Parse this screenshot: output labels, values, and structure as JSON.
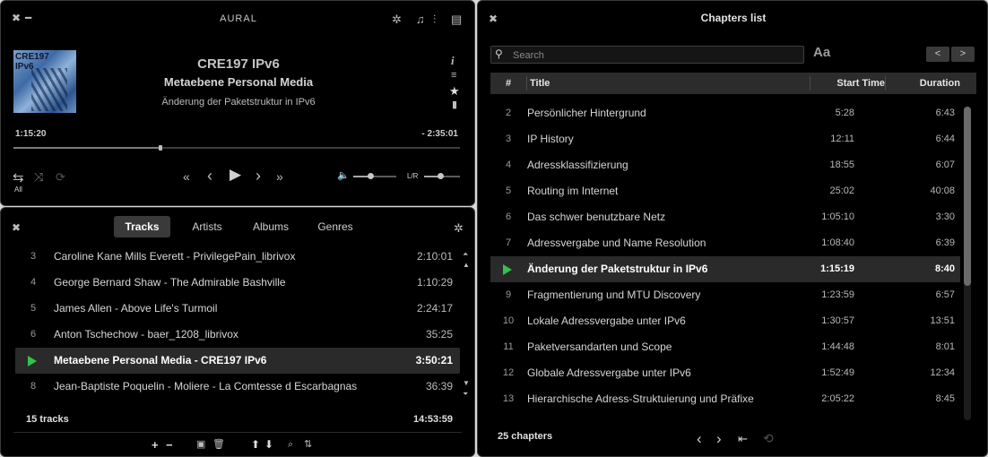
{
  "player": {
    "app_title": "AURAL",
    "album_art": {
      "line1": "CRE197",
      "line2": "IPv6"
    },
    "track_title": "CRE197 IPv6",
    "track_artist": "Metaebene Personal Media",
    "track_album": "Änderung der Paketstruktur in IPv6",
    "elapsed": "1:15:20",
    "remaining": "- 2:35:01",
    "seek_fraction": 0.33,
    "repeat_label": "All",
    "balance_label": "L/R",
    "volume_fraction": 0.4,
    "balance_fraction": 0.45,
    "colors": {
      "background": "#000000",
      "text": "#dcdcdc",
      "accent_play": "#33c24a"
    }
  },
  "playlist": {
    "tabs": [
      "Tracks",
      "Artists",
      "Albums",
      "Genres"
    ],
    "active_tab": "Tracks",
    "rows": [
      {
        "num": "3",
        "name": "Caroline Kane Mills Everett - PrivilegePain_librivox",
        "duration": "2:10:01",
        "playing": false
      },
      {
        "num": "4",
        "name": "George Bernard Shaw - The Admirable Bashville",
        "duration": "1:10:29",
        "playing": false
      },
      {
        "num": "5",
        "name": "James Allen - Above Life's Turmoil",
        "duration": "2:24:17",
        "playing": false
      },
      {
        "num": "6",
        "name": "Anton Tschechow - baer_1208_librivox",
        "duration": "35:25",
        "playing": false
      },
      {
        "num": "",
        "name": "Metaebene Personal Media - CRE197 IPv6",
        "duration": "3:50:21",
        "playing": true
      },
      {
        "num": "8",
        "name": "Jean-Baptiste Poquelin - Moliere - La Comtesse d Escarbagnas",
        "duration": "36:39",
        "playing": false
      }
    ],
    "footer": {
      "count": "15 tracks",
      "total": "14:53:59"
    }
  },
  "chapters": {
    "title": "Chapters list",
    "search_placeholder": "Search",
    "font_toggle": "Aa",
    "nav_prev": "<",
    "nav_next": ">",
    "columns": [
      "#",
      "Title",
      "Start Time",
      "Duration"
    ],
    "rows": [
      {
        "num": "2",
        "title": "Persönlicher Hintergrund",
        "start": "5:28",
        "duration": "6:43",
        "playing": false
      },
      {
        "num": "3",
        "title": "IP History",
        "start": "12:11",
        "duration": "6:44",
        "playing": false
      },
      {
        "num": "4",
        "title": "Adressklassifizierung",
        "start": "18:55",
        "duration": "6:07",
        "playing": false
      },
      {
        "num": "5",
        "title": "Routing im Internet",
        "start": "25:02",
        "duration": "40:08",
        "playing": false
      },
      {
        "num": "6",
        "title": "Das schwer benutzbare Netz",
        "start": "1:05:10",
        "duration": "3:30",
        "playing": false
      },
      {
        "num": "7",
        "title": "Adressvergabe und Name Resolution",
        "start": "1:08:40",
        "duration": "6:39",
        "playing": false
      },
      {
        "num": "",
        "title": "Änderung der Paketstruktur in IPv6",
        "start": "1:15:19",
        "duration": "8:40",
        "playing": true
      },
      {
        "num": "9",
        "title": "Fragmentierung und MTU Discovery",
        "start": "1:23:59",
        "duration": "6:57",
        "playing": false
      },
      {
        "num": "10",
        "title": "Lokale Adressvergabe unter IPv6",
        "start": "1:30:57",
        "duration": "13:51",
        "playing": false
      },
      {
        "num": "11",
        "title": "Paketversandarten und Scope",
        "start": "1:44:48",
        "duration": "8:01",
        "playing": false
      },
      {
        "num": "12",
        "title": "Globale Adressvergabe unter IPv6",
        "start": "1:52:49",
        "duration": "12:34",
        "playing": false
      },
      {
        "num": "13",
        "title": "Hierarchische Adress-Struktuierung und Präfixe",
        "start": "2:05:22",
        "duration": "8:45",
        "playing": false
      }
    ],
    "count": "25 chapters"
  }
}
